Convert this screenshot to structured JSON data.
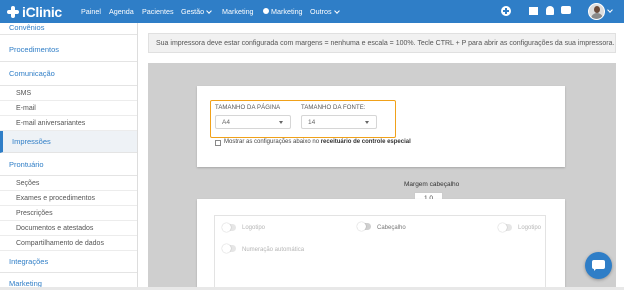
{
  "brand": {
    "logo_text": "iClinic",
    "accent": "#2f7ec7",
    "highlight": "#f0a11a"
  },
  "nav": {
    "painel": "Painel",
    "agenda": "Agenda",
    "pacientes": "Pacientes",
    "gestao": "Gestão",
    "marketing": "Marketing",
    "marketing2": "Marketing",
    "outros": "Outros"
  },
  "sidebar": {
    "convenios": "Convênios",
    "procedimentos": "Procedimentos",
    "comunicacao": "Comunicação",
    "sms": "SMS",
    "email": "E-mail",
    "email_aniversariantes": "E-mail aniversariantes",
    "impressoes": "Impressões",
    "prontuario": "Prontuário",
    "secoes": "Seções",
    "exames": "Exames e procedimentos",
    "prescricoes": "Prescrições",
    "documentos": "Documentos e atestados",
    "compartilhamento": "Compartilhamento de dados",
    "integracoes": "Integrações",
    "marketing": "Marketing"
  },
  "main": {
    "alert": "Sua impressora deve estar configurada com margens = nenhuma e escala = 100%. Tecle CTRL + P para abrir as configurações da sua impressora.",
    "page_size_label": "TAMANHO DA PÁGINA",
    "page_size_value": "A4",
    "font_size_label": "TAMANHO DA FONTE:",
    "font_size_value": "14",
    "checkbox_text": "Mostrar as configurações abaixo no ",
    "checkbox_bold": "receituário de controle especial",
    "margin_label": "Margem cabeçalho",
    "margin_value": "1.0",
    "toggles": {
      "logotipo_left": "Logotipo",
      "cabecalho": "Cabeçalho",
      "logotipo_right": "Logotipo",
      "numeracao": "Numeração automática"
    }
  }
}
